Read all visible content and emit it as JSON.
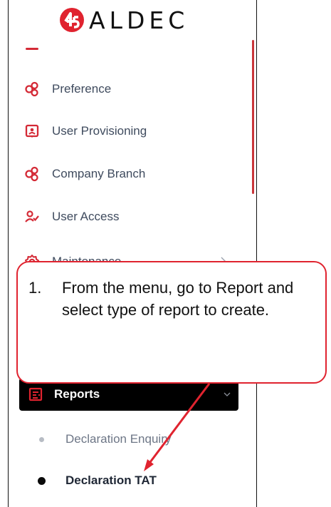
{
  "brand": {
    "logo_text": "ALDEC"
  },
  "menu": {
    "items": [
      {
        "label": "Preference",
        "icon": "hex-nodes-icon"
      },
      {
        "label": "User Provisioning",
        "icon": "user-badge-icon"
      },
      {
        "label": "Company Branch",
        "icon": "hex-nodes-icon"
      },
      {
        "label": "User Access",
        "icon": "user-check-icon"
      },
      {
        "label": "Maintenance",
        "icon": "gear-icon",
        "has_submenu": true
      }
    ],
    "reports": {
      "label": "Reports",
      "icon": "report-icon",
      "expanded": true
    },
    "report_subitems": [
      {
        "label": "Declaration Enquiry",
        "active": false
      },
      {
        "label": "Declaration TAT",
        "active": true
      }
    ]
  },
  "callout": {
    "number": "1.",
    "text": "From the menu, go to Report and select type of report to create."
  },
  "colors": {
    "accent": "#e0232f",
    "text": "#3f4b5e",
    "active_bar": "#000000"
  }
}
